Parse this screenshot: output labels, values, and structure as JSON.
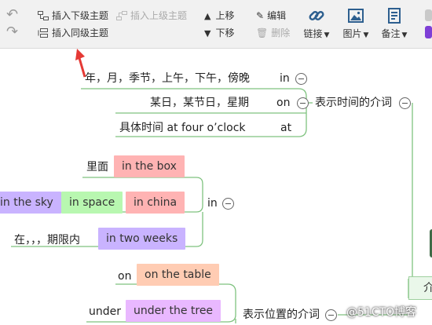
{
  "toolbar": {
    "insert_child": "插入下级主题",
    "insert_parent": "插入上级主题",
    "insert_sibling": "插入同级主题",
    "move_up": "上移",
    "move_down": "下移",
    "edit": "编辑",
    "delete": "删除",
    "link": "链接",
    "image": "图片",
    "note": "备注"
  },
  "map": {
    "time_group": {
      "parent_label": "表示时间的介词",
      "items": [
        {
          "text": "年，月，季节，上午，下午，傍晚",
          "prep": "in"
        },
        {
          "text": "某日，某节日，星期",
          "prep": "on"
        },
        {
          "text": "具体时间  at four o’clock",
          "prep": "at"
        }
      ]
    },
    "place_group": {
      "parent_label": "表示位置的介词",
      "in_label": "in",
      "in_examples": {
        "label_inside": "里面",
        "box": "in the box",
        "sky": "in the sky",
        "space": "in space",
        "china": "in china",
        "within_label": "在，，，期限内",
        "weeks": "in two weeks"
      },
      "on_label": "on",
      "on_example": "on the table",
      "under_label": "under",
      "under_example": "under the tree"
    },
    "root_partial": "介"
  },
  "colors": {
    "line": "#7fc27f",
    "arrow": "#e53935",
    "pink": "#ffb3b3",
    "green": "#b8f7b0",
    "purple": "#c9b3ff"
  },
  "watermark": "@51CTO博客"
}
